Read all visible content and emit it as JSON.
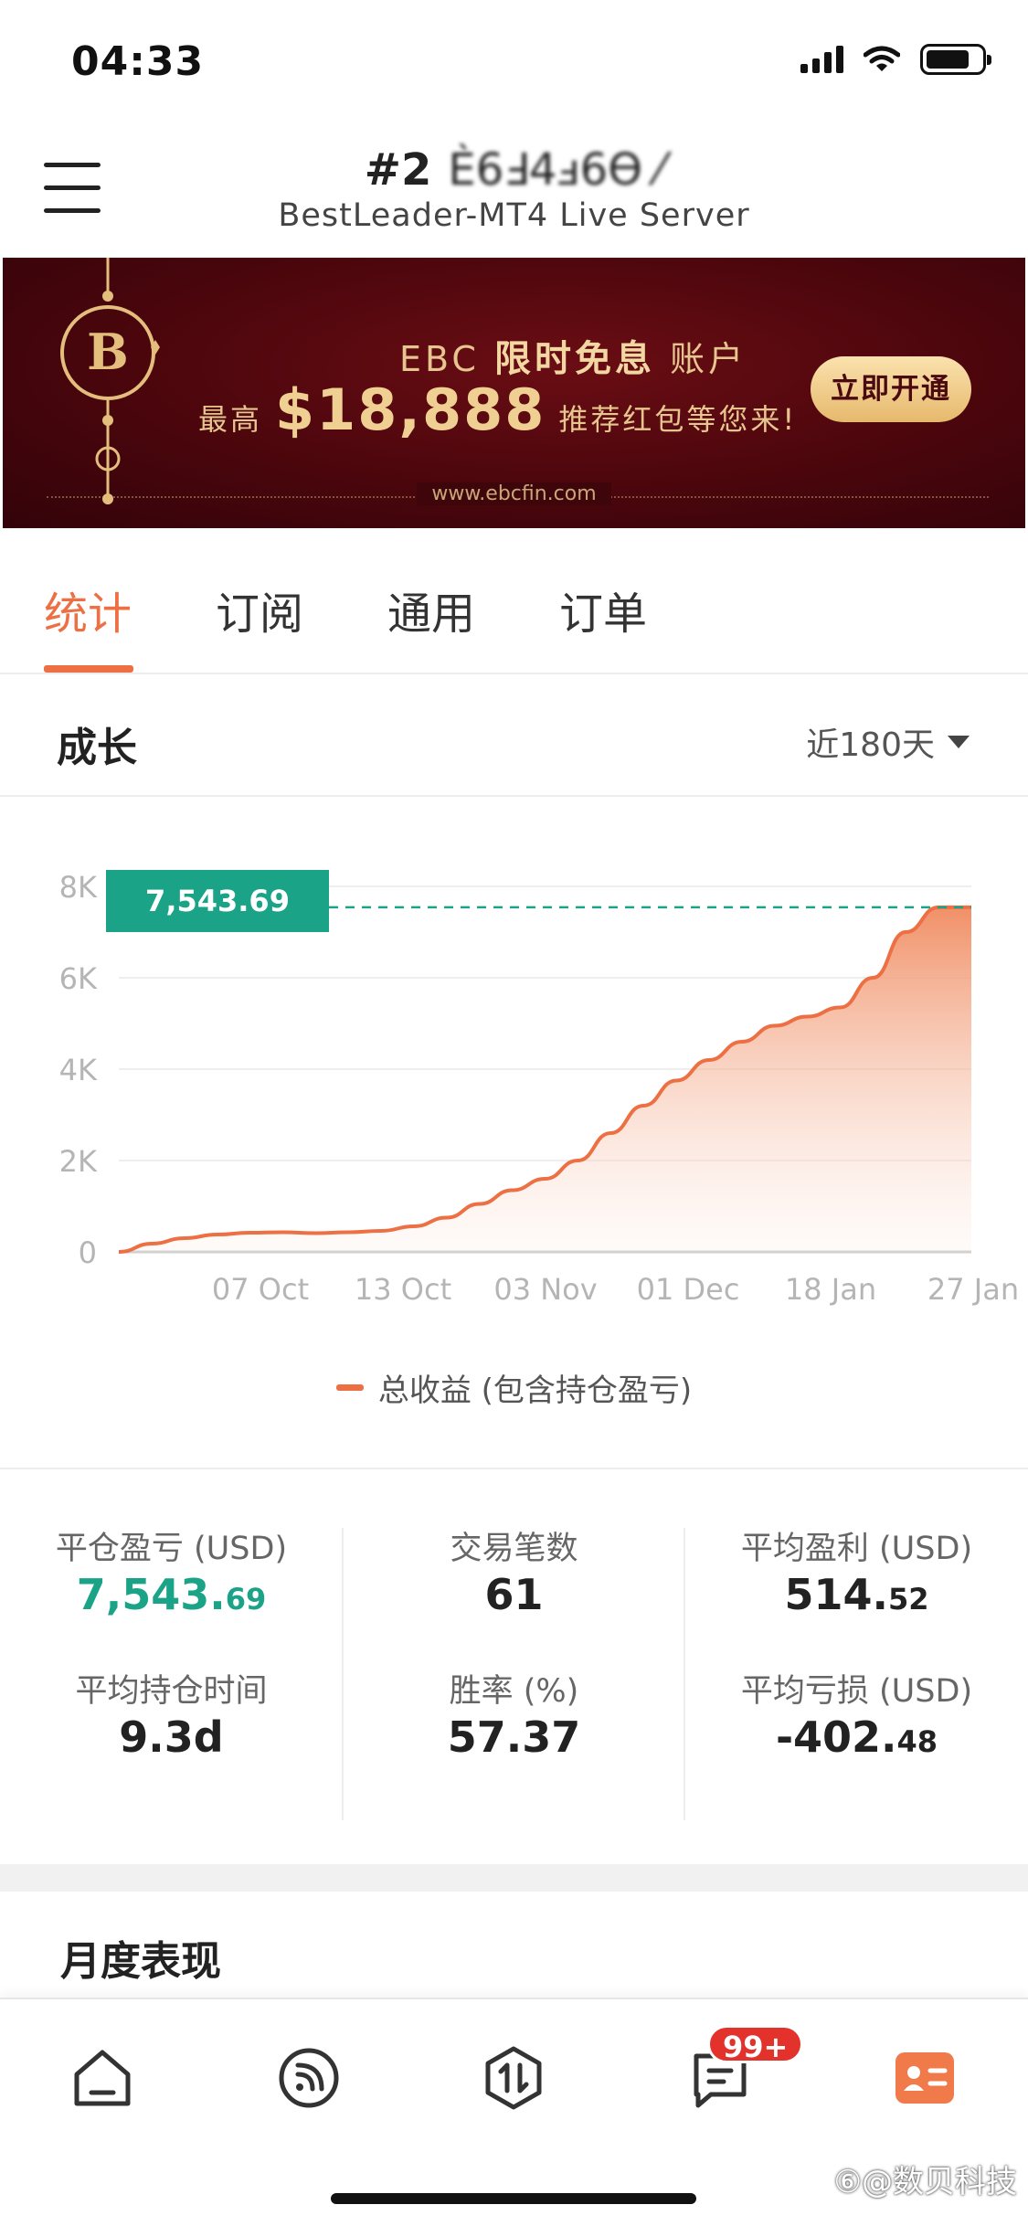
{
  "status_bar": {
    "time": "04:33"
  },
  "header": {
    "account_prefix": "#2",
    "account_masked": "Ѐ6Ⅎ4ⅎ6Ѳ ⁄",
    "server": "BestLeader-MT4 Live Server"
  },
  "banner": {
    "line1_prefix": "EBC ",
    "line1_highlight": "限时免息",
    "line1_suffix": " 账户",
    "line2_prefix": "最高",
    "amount": "$18,888",
    "line2_suffix": "推荐红包等您来!",
    "button_label": "立即开通",
    "url": "www.ebcfin.com"
  },
  "tabs": [
    "统计",
    "订阅",
    "通用",
    "订单"
  ],
  "growth": {
    "title": "成长",
    "range_label": "近180天",
    "badge_value": "7,543.69 USD",
    "legend_label": "总收益 (包含持仓盈亏)"
  },
  "chart_data": {
    "type": "area",
    "ylim": [
      0,
      8000
    ],
    "y_ticks": [
      "0",
      "2K",
      "4K",
      "6K",
      "8K"
    ],
    "x_tick_labels": [
      "07 Oct",
      "13 Oct",
      "03 Nov",
      "01 Dec",
      "18 Jan",
      "27 Jan"
    ],
    "series": [
      {
        "name": "总收益 (包含持仓盈亏)",
        "color": "#ec7043",
        "values": [
          0,
          180,
          300,
          380,
          420,
          430,
          410,
          430,
          460,
          560,
          750,
          1050,
          1350,
          1600,
          2000,
          2600,
          3200,
          3750,
          4200,
          4600,
          4950,
          5150,
          5350,
          6000,
          7000,
          7543.69,
          7543.69
        ]
      }
    ],
    "reference_line": {
      "value": 7543.69,
      "style": "dashed",
      "color": "#1aa387"
    }
  },
  "stats": {
    "realized_pl": {
      "label": "平仓盈亏 (USD)",
      "main": "7,543.",
      "small": "69"
    },
    "trades": {
      "label": "交易笔数",
      "value": "61"
    },
    "avg_profit": {
      "label": "平均盈利 (USD)",
      "main": "514.",
      "small": "52"
    },
    "avg_hold": {
      "label": "平均持仓时间",
      "value": "9.3d"
    },
    "win_rate": {
      "label": "胜率 (%)",
      "value": "57.37"
    },
    "avg_loss": {
      "label": "平均亏损 (USD)",
      "main": "-402.",
      "small": "48"
    }
  },
  "monthly": {
    "title": "月度表现"
  },
  "bottom_nav": {
    "items": [
      "home-icon",
      "feed-icon",
      "trade-icon",
      "messages-icon",
      "profile-icon"
    ],
    "badge": "99+",
    "active_color": "#f07a4a"
  },
  "watermark": "⑥@数贝科技"
}
